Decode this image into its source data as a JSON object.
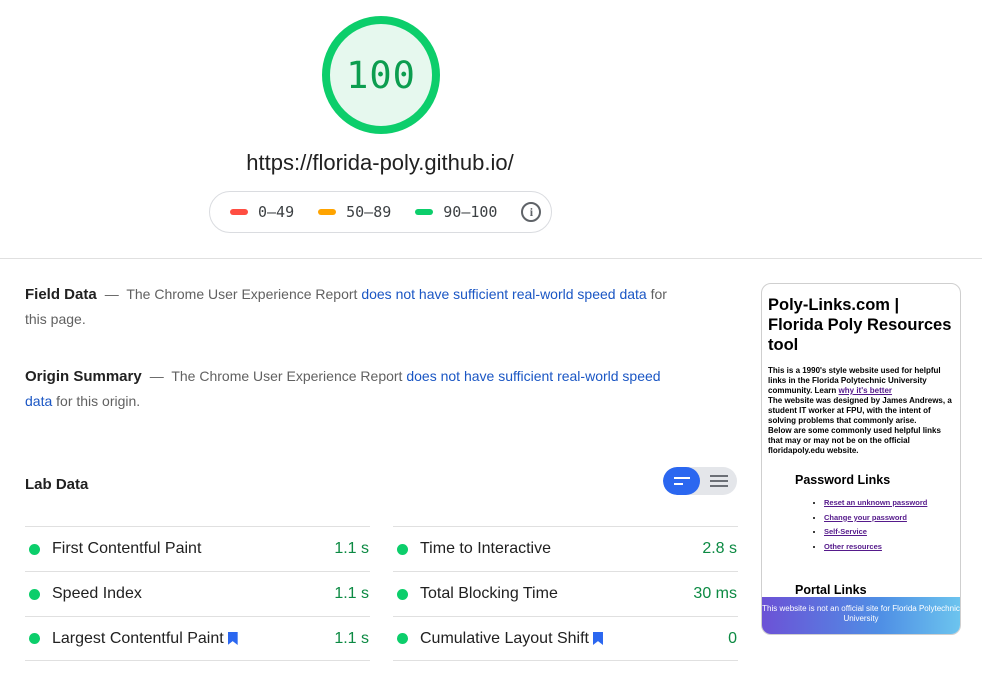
{
  "score": {
    "value": "100",
    "color": "#0cce6b",
    "fill": "#e6f8ee"
  },
  "url": "https://florida-poly.github.io/",
  "legend": {
    "ranges": [
      {
        "label": "0–49",
        "color": "#ff4e42"
      },
      {
        "label": "50–89",
        "color": "#ffa400"
      },
      {
        "label": "90–100",
        "color": "#0cce6b"
      }
    ],
    "info_icon": "info-icon"
  },
  "field_data": {
    "title": "Field Data",
    "dash": "—",
    "text_before": "The Chrome User Experience Report",
    "link": "does not have sufficient real-world speed data",
    "text_after": "for this page."
  },
  "origin_summary": {
    "title": "Origin Summary",
    "dash": "—",
    "text_before": "The Chrome User Experience Report",
    "link": "does not have sufficient real-world speed data",
    "text_after": "for this origin."
  },
  "lab_data": {
    "title": "Lab Data",
    "toggle": {
      "active": "bars-icon",
      "inactive": "list-icon"
    },
    "metrics_left": [
      {
        "name": "First Contentful Paint",
        "value": "1.1 s",
        "bookmark": false
      },
      {
        "name": "Speed Index",
        "value": "1.1 s",
        "bookmark": false
      },
      {
        "name": "Largest Contentful Paint",
        "value": "1.1 s",
        "bookmark": true
      }
    ],
    "metrics_right": [
      {
        "name": "Time to Interactive",
        "value": "2.8 s",
        "bookmark": false
      },
      {
        "name": "Total Blocking Time",
        "value": "30 ms",
        "bookmark": false
      },
      {
        "name": "Cumulative Layout Shift",
        "value": "0",
        "bookmark": true
      }
    ],
    "status_color": "#0cce6b",
    "value_color": "#0c8a43"
  },
  "thumbnail": {
    "heading": "Poly-Links.com | Florida Poly Resources tool",
    "intro_1": "This is a 1990's style website used for helpful links in the Florida Polytechnic University community. Learn",
    "intro_link": "why it's better",
    "intro_2": "The website was designed by James Andrews, a student IT worker at FPU, with the intent of solving problems that commonly arise.",
    "intro_3": "Below are some commonly used helpful links that may or may not be on the official floridapoly.edu website.",
    "section_title": "Password Links",
    "links": [
      "Reset an unknown password",
      "Change your password",
      "Self-Service",
      "Other resources"
    ],
    "next_section": "Portal Links",
    "banner": "This website is not an official site for Florida Polytechnic University"
  }
}
